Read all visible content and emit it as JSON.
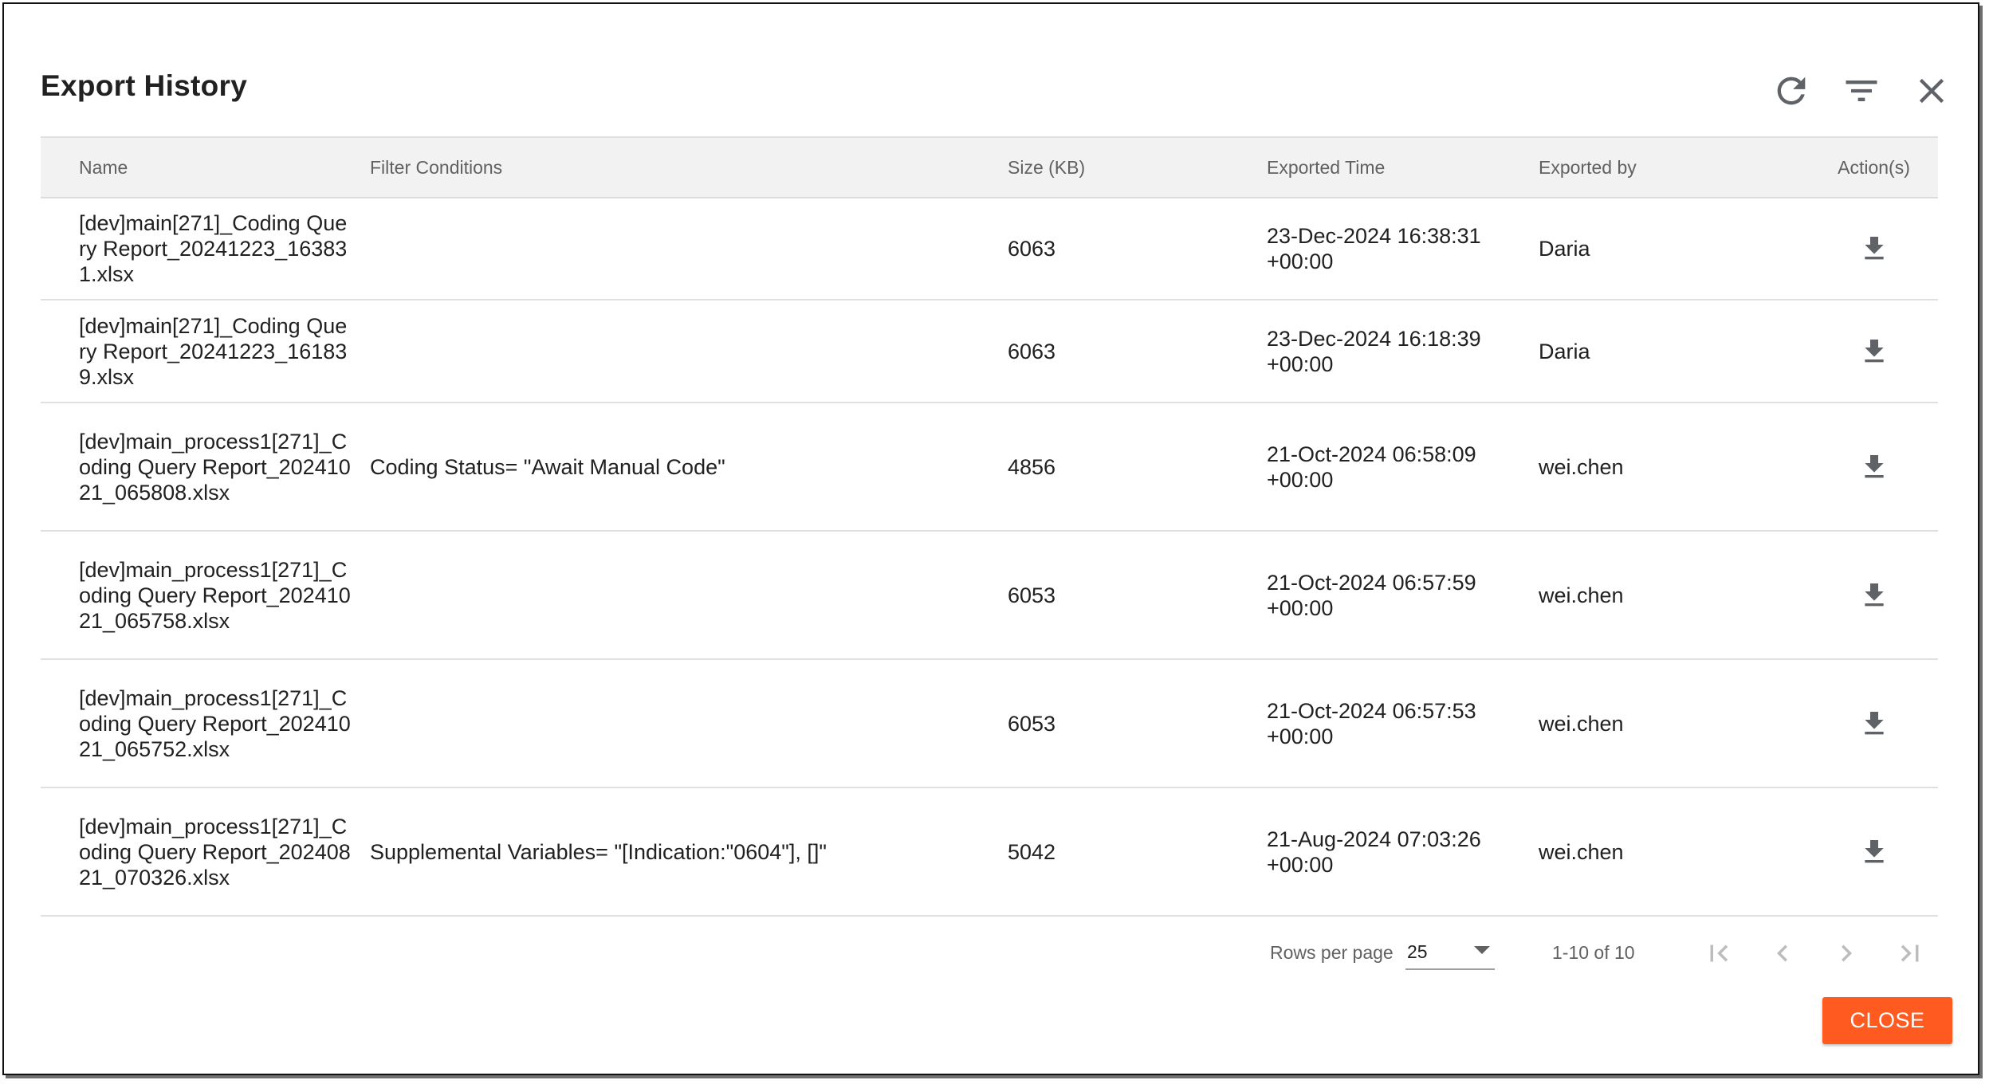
{
  "dialog": {
    "title": "Export History",
    "header_icons": [
      "refresh-icon",
      "filter-list-icon",
      "close-icon"
    ]
  },
  "table": {
    "columns": [
      "Name",
      "Filter Conditions",
      "Size (KB)",
      "Exported Time",
      "Exported by",
      "Action(s)"
    ],
    "rows": [
      {
        "name": "[dev]main[271]_Coding Query Report_20241223_163831.xlsx",
        "filter": "",
        "size": "6063",
        "time": "23-Dec-2024 16:38:31 +00:00",
        "by": "Daria"
      },
      {
        "name": "[dev]main[271]_Coding Query Report_20241223_161839.xlsx",
        "filter": "",
        "size": "6063",
        "time": "23-Dec-2024 16:18:39 +00:00",
        "by": "Daria"
      },
      {
        "name": "[dev]main_process1[271]_Coding Query Report_20241021_065808.xlsx",
        "filter": "Coding Status= \"Await Manual Code\"",
        "size": "4856",
        "time": "21-Oct-2024 06:58:09 +00:00",
        "by": "wei.chen"
      },
      {
        "name": "[dev]main_process1[271]_Coding Query Report_20241021_065758.xlsx",
        "filter": "",
        "size": "6053",
        "time": "21-Oct-2024 06:57:59 +00:00",
        "by": "wei.chen"
      },
      {
        "name": "[dev]main_process1[271]_Coding Query Report_20241021_065752.xlsx",
        "filter": "",
        "size": "6053",
        "time": "21-Oct-2024 06:57:53 +00:00",
        "by": "wei.chen"
      },
      {
        "name": "[dev]main_process1[271]_Coding Query Report_20240821_070326.xlsx",
        "filter": "Supplemental Variables= \"[Indication:\"0604\"], []\"",
        "size": "5042",
        "time": "21-Aug-2024 07:03:26 +00:00",
        "by": "wei.chen"
      }
    ],
    "action_icon": "download-icon"
  },
  "pagination": {
    "rows_per_page_label": "Rows per page",
    "rows_per_page_value": "25",
    "range": "1-10 of 10"
  },
  "footer": {
    "close_label": "CLOSE"
  },
  "colors": {
    "accent": "#ff5a1f",
    "header_bg": "#f2f2f2",
    "text": "#212121",
    "muted": "#616161"
  }
}
